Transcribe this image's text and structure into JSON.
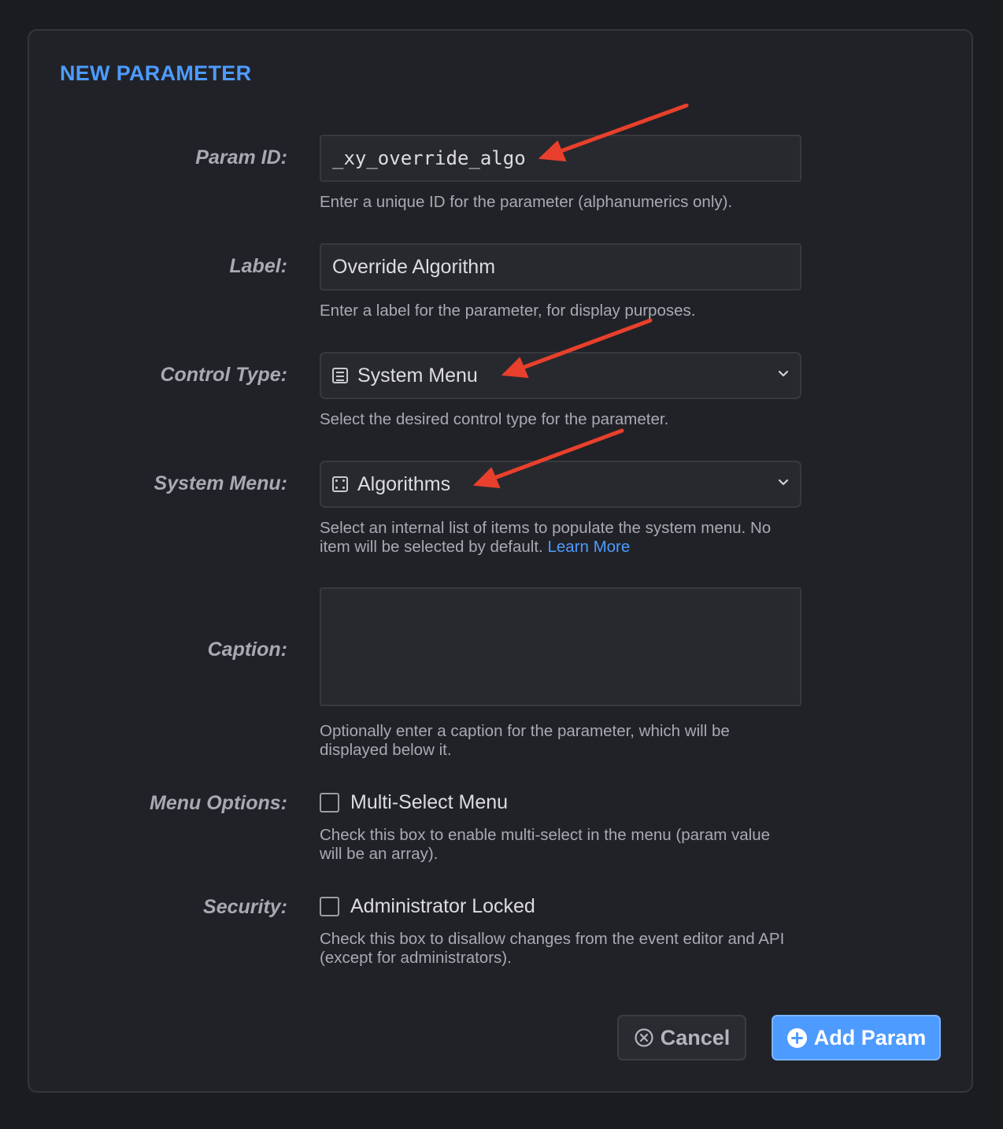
{
  "dialog": {
    "title": "NEW PARAMETER"
  },
  "fields": {
    "param_id": {
      "label": "Param ID:",
      "value": "_xy_override_algo",
      "help": "Enter a unique ID for the parameter (alphanumerics only)."
    },
    "label": {
      "label": "Label:",
      "value": "Override Algorithm",
      "help": "Enter a label for the parameter, for display purposes."
    },
    "control_type": {
      "label": "Control Type:",
      "value": "System Menu",
      "icon": "list-icon",
      "help": "Select the desired control type for the parameter."
    },
    "system_menu": {
      "label": "System Menu:",
      "value": "Algorithms",
      "icon": "dice-icon",
      "help": "Select an internal list of items to populate the system menu. No item will be selected by default.",
      "learn_more": "Learn More"
    },
    "caption": {
      "label": "Caption:",
      "value": "",
      "help": "Optionally enter a caption for the parameter, which will be displayed below it."
    },
    "menu_options": {
      "label": "Menu Options:",
      "checkbox_label": "Multi-Select Menu",
      "checked": false,
      "help": "Check this box to enable multi-select in the menu (param value will be an array)."
    },
    "security": {
      "label": "Security:",
      "checkbox_label": "Administrator Locked",
      "checked": false,
      "help": "Check this box to disallow changes from the event editor and API (except for administrators)."
    }
  },
  "buttons": {
    "cancel": "Cancel",
    "add": "Add Param"
  },
  "colors": {
    "accent": "#4d9bff",
    "annotation_arrow": "#e8402c"
  }
}
